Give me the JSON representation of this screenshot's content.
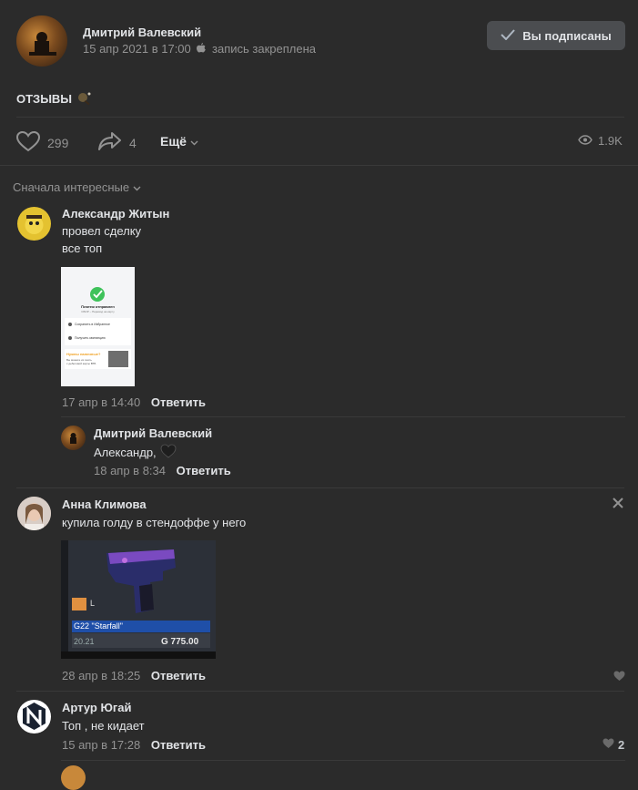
{
  "post": {
    "author": "Дмитрий Валевский",
    "date": "15 апр 2021 в 17:00",
    "pinned": "запись закреплена",
    "subscribe_label": "Вы подписаны",
    "text": "ОТЗЫВЫ",
    "likes": "299",
    "shares": "4",
    "more_label": "Ещё",
    "views": "1.9K"
  },
  "comments": {
    "sort_label": "Сначала интересные",
    "reply_label": "Ответить",
    "items": [
      {
        "author": "Александр Житын",
        "line1": "провел сделку",
        "line2": "все топ",
        "date": "17 апр в 14:40"
      },
      {
        "author": "Дмитрий Валевский",
        "text": "Александр,",
        "date": "18 апр в 8:34"
      },
      {
        "author": "Анна Климова",
        "text": "купила голду в стендоффе у него",
        "date": "28 апр в 18:25"
      },
      {
        "author": "Артур Югай",
        "text": "Топ , не кидает",
        "date": "15 апр в 17:28",
        "likes": "2"
      }
    ]
  },
  "receipt": {
    "title": "Платеж отправлен",
    "subtitle": "СБОР – Перевод на карту",
    "row1": "Сохранить в Избранное",
    "row2": "Получить квитанцию",
    "promo_title": "Нужны наличные?",
    "promo_text1": "Вы можете их снять",
    "promo_text2": "с дебетовой карты ВТБ"
  },
  "gun_card": {
    "tag": "L",
    "name": "G22 \"Starfall\"",
    "year": "20.21",
    "price": "G 775.00"
  },
  "colors": {
    "background": "#2b2b2b",
    "button": "#4b4d50",
    "muted": "#939393",
    "accent_blue": "#1f4fa8"
  }
}
